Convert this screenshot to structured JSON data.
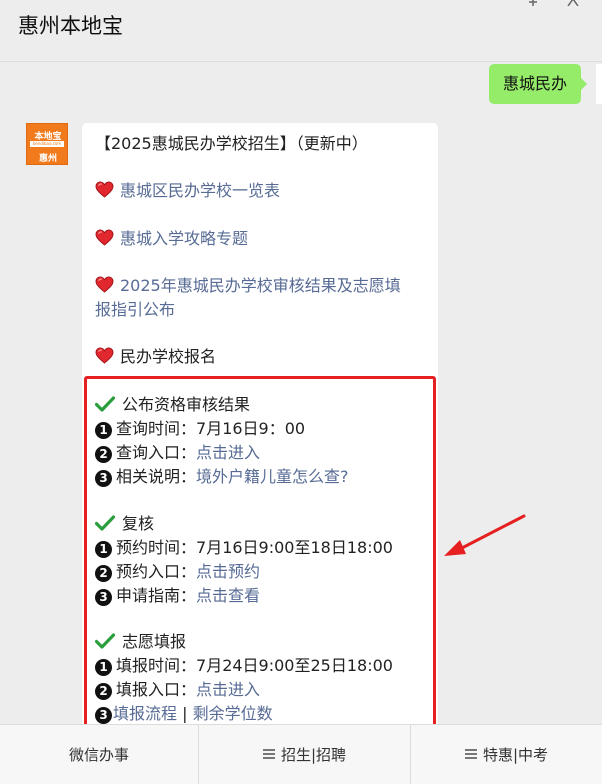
{
  "header": {
    "title": "惠州本地宝"
  },
  "outgoing_message": "惠城民办",
  "avatar": {
    "logo_top": "本地宝",
    "logo_mid": "bendibao.com",
    "logo_bottom": "惠州"
  },
  "message": {
    "heading": "【2025惠城民办学校招生】（更新中）",
    "links": [
      "惠城区民办学校一览表",
      "惠城入学攻略专题",
      "2025年惠城民办学校审核结果及志愿填",
      "报指引公布",
      "民办学校报名"
    ],
    "sections": [
      {
        "title": "公布资格审核结果",
        "rows": [
          {
            "num": "1",
            "label": "查询时间：",
            "value": "7月16日9：00",
            "link": ""
          },
          {
            "num": "2",
            "label": "查询入口：",
            "value": "",
            "link": "点击进入"
          },
          {
            "num": "3",
            "label": "相关说明：",
            "value": "",
            "link": "境外户籍儿童怎么查?"
          }
        ]
      },
      {
        "title": "复核",
        "rows": [
          {
            "num": "1",
            "label": "预约时间：",
            "value": "7月16日9:00至18日18:00",
            "link": ""
          },
          {
            "num": "2",
            "label": "预约入口：",
            "value": "",
            "link": "点击预约"
          },
          {
            "num": "3",
            "label": "申请指南：",
            "value": "",
            "link": "点击查看"
          }
        ]
      },
      {
        "title": "志愿填报",
        "rows": [
          {
            "num": "1",
            "label": "填报时间：",
            "value": "7月24日9:00至25日18:00",
            "link": ""
          },
          {
            "num": "2",
            "label": "填报入口：",
            "value": "",
            "link": "点击进入"
          }
        ],
        "last_row": {
          "num": "3",
          "link_a": "填报流程",
          "separator": " | ",
          "link_b": "剩余学位数"
        }
      }
    ]
  },
  "bottom_menu": [
    "微信办事",
    "招生|招聘",
    "特惠|中考"
  ],
  "colors": {
    "bubble_green": "#95ec69",
    "link": "#576b95",
    "highlight_red": "#e62020",
    "heart": "#e0282e",
    "check": "#2a9d3c"
  }
}
